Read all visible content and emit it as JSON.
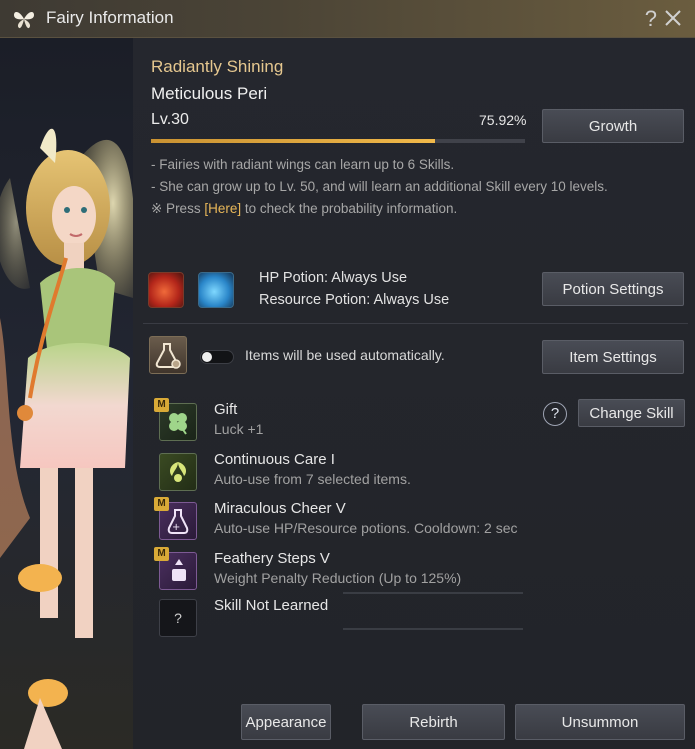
{
  "window": {
    "title": "Fairy Information",
    "help_label": "?"
  },
  "fairy": {
    "grade": "Radiantly Shining",
    "name": "Meticulous Peri",
    "level": "Lv.30",
    "progress_text": "75.92%",
    "progress_fraction": 0.7592,
    "growth_button": "Growth",
    "notes": {
      "line1": "- Fairies with radiant wings can learn up to 6 Skills.",
      "line2": "- She can grow up to Lv. 50, and will learn an additional Skill every 10 levels.",
      "line3_prefix": "※ Press ",
      "line3_link": "[Here]",
      "line3_suffix": " to check the probability information."
    }
  },
  "potions": {
    "hp": "HP Potion: Always Use",
    "resource": "Resource Potion: Always Use",
    "settings_button": "Potion Settings"
  },
  "items": {
    "auto_text": "Items will be used automatically.",
    "settings_button": "Item Settings",
    "auto_enabled": false
  },
  "skills": {
    "change_button": "Change Skill",
    "info_label": "?",
    "list": [
      {
        "name": "Gift",
        "desc": "Luck +1",
        "badge": "M",
        "icon": "clover-icon"
      },
      {
        "name": "Continuous Care I",
        "desc": "Auto-use from 7 selected items.",
        "badge": "",
        "icon": "fairy-care-icon"
      },
      {
        "name": "Miraculous Cheer V",
        "desc": "Auto-use HP/Resource potions. Cooldown: 2 sec",
        "badge": "M",
        "icon": "potion-cheer-icon"
      },
      {
        "name": "Feathery Steps V",
        "desc": "Weight Penalty Reduction (Up to 125%)",
        "badge": "M",
        "icon": "weight-icon"
      },
      {
        "name": "Skill Not Learned",
        "desc": "",
        "badge": "",
        "icon": "unknown-skill-icon",
        "placeholder": "?"
      }
    ]
  },
  "footer": {
    "appearance": "Appearance",
    "rebirth": "Rebirth",
    "unsummon": "Unsummon"
  },
  "colors": {
    "accent_gold": "#e5c78f",
    "link": "#e8b759",
    "progress": "#f1b94a"
  }
}
